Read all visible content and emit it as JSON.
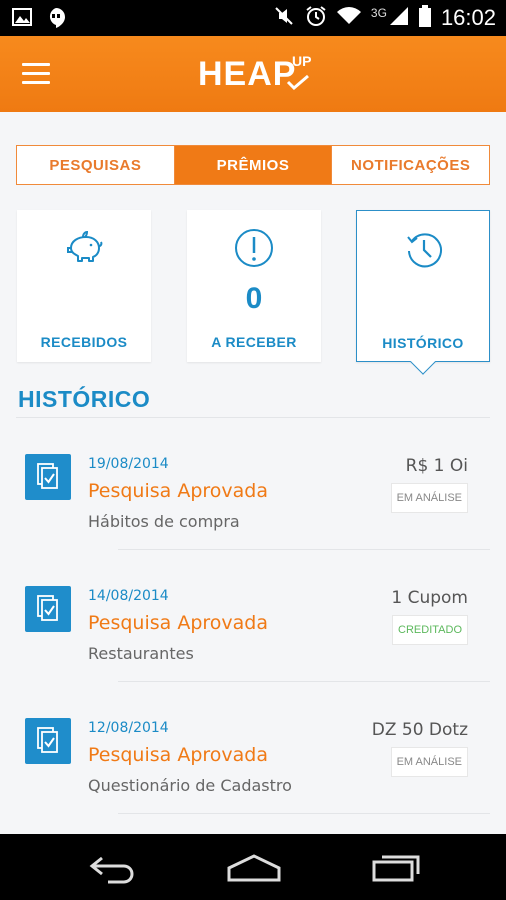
{
  "status_bar": {
    "time": "16:02",
    "network": "3G"
  },
  "header": {
    "logo_main": "HEAP",
    "logo_sup": "UP"
  },
  "tabs": [
    {
      "label": "PESQUISAS",
      "active": false
    },
    {
      "label": "PRÊMIOS",
      "active": true
    },
    {
      "label": "NOTIFICAÇÕES",
      "active": false
    }
  ],
  "cards": [
    {
      "label": "RECEBIDOS",
      "icon": "piggy-bank-icon"
    },
    {
      "label": "A RECEBER",
      "count": "0",
      "icon": "exclamation-icon"
    },
    {
      "label": "HISTÓRICO",
      "icon": "history-clock-icon",
      "selected": true
    }
  ],
  "section": {
    "title": "HISTÓRICO"
  },
  "history": [
    {
      "date": "19/08/2014",
      "title": "Pesquisa Aprovada",
      "subtitle": "Hábitos de compra",
      "amount": "R$ 1 Oi",
      "status": "EM ANÁLISE"
    },
    {
      "date": "14/08/2014",
      "title": "Pesquisa Aprovada",
      "subtitle": "Restaurantes",
      "amount": "1 Cupom",
      "status": "CREDITADO"
    },
    {
      "date": "12/08/2014",
      "title": "Pesquisa Aprovada",
      "subtitle": "Questionário de Cadastro",
      "amount": "DZ 50 Dotz",
      "status": "EM ANÁLISE"
    }
  ],
  "colors": {
    "orange": "#f07a16",
    "blue": "#1b8bc6",
    "credited": "#5cb85c"
  }
}
